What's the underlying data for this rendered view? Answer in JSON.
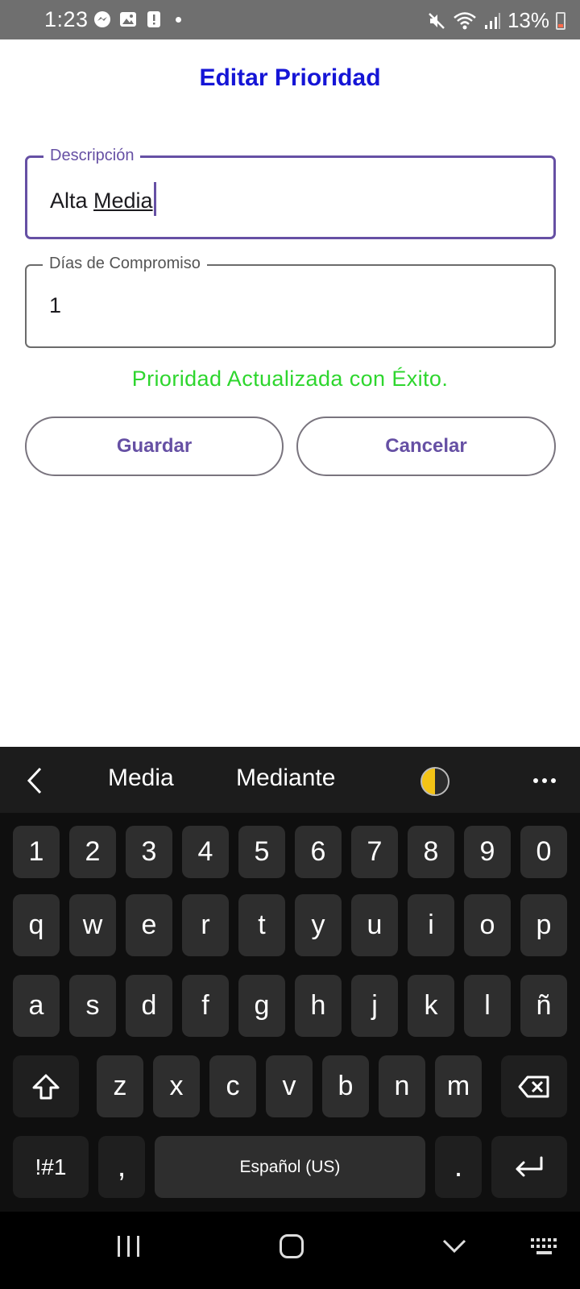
{
  "status_bar": {
    "time": "1:23",
    "battery_text": "13%",
    "left_icons": [
      "messenger-icon",
      "gallery-icon",
      "alert-icon",
      "dot"
    ],
    "right_icons": [
      "mute-icon",
      "wifi-icon",
      "signal-icon",
      "battery-icon"
    ]
  },
  "page": {
    "title": "Editar Prioridad"
  },
  "form": {
    "description": {
      "label": "Descripción",
      "value_plain": "Alta ",
      "value_composing": "Media"
    },
    "days": {
      "label": "Días de Compromiso",
      "value": "1"
    },
    "success_message": "Prioridad Actualizada con Éxito.",
    "save_label": "Guardar",
    "cancel_label": "Cancelar"
  },
  "keyboard": {
    "suggestions": [
      "Media",
      "Mediante"
    ],
    "numbers": [
      "1",
      "2",
      "3",
      "4",
      "5",
      "6",
      "7",
      "8",
      "9",
      "0"
    ],
    "row1": [
      "q",
      "w",
      "e",
      "r",
      "t",
      "y",
      "u",
      "i",
      "o",
      "p"
    ],
    "row2": [
      "a",
      "s",
      "d",
      "f",
      "g",
      "h",
      "j",
      "k",
      "l",
      "ñ"
    ],
    "row3": [
      "z",
      "x",
      "c",
      "v",
      "b",
      "n",
      "m"
    ],
    "symbols_label": "!#1",
    "comma_label": ",",
    "space_label": "Español (US)",
    "period_label": "."
  },
  "colors": {
    "title": "#1515d6",
    "accent": "#6650a4",
    "success": "#2ed62e"
  }
}
